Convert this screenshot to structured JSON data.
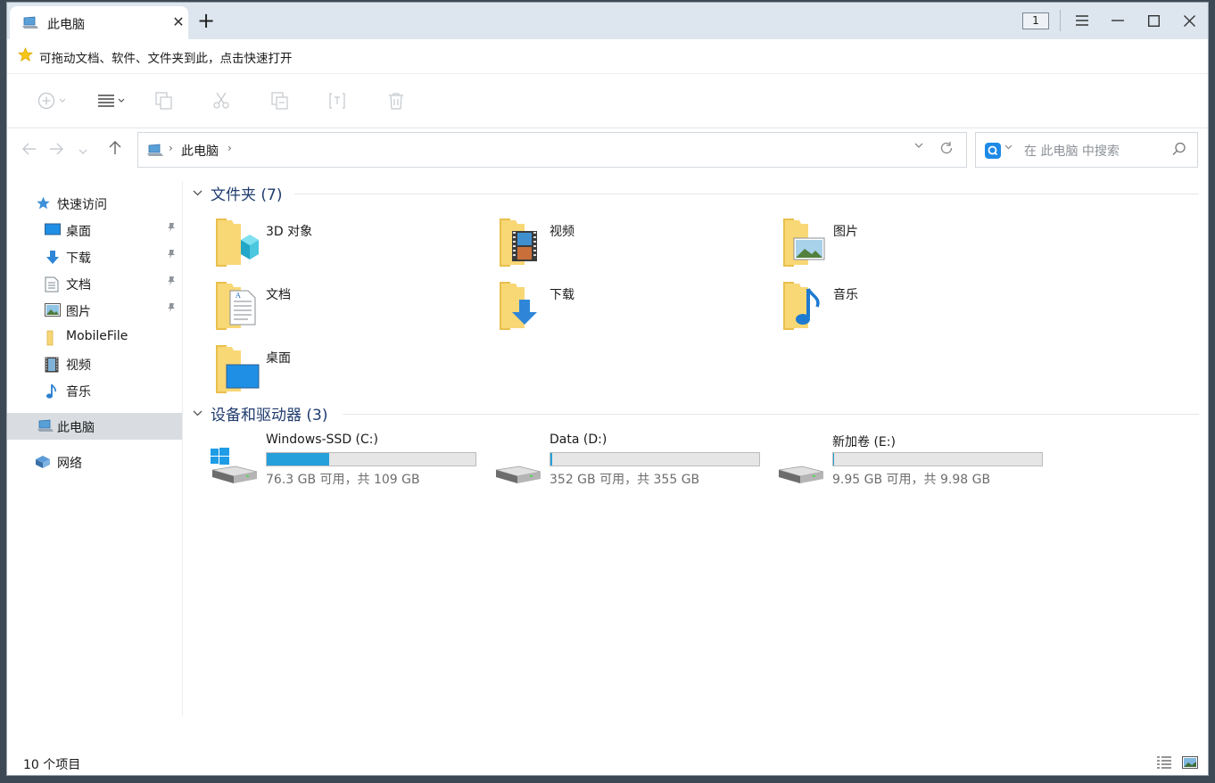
{
  "window": {
    "tab_title": "此电脑",
    "tab_close": "✕",
    "new_tab": "+",
    "tab_count": "1"
  },
  "quick_bar": {
    "text": "可拖动文档、软件、文件夹到此，点击快速打开"
  },
  "address": {
    "path": "此电脑",
    "separator": "›"
  },
  "search": {
    "placeholder": "在 此电脑 中搜索"
  },
  "sidebar": {
    "quick_access": "快速访问",
    "items": [
      {
        "label": "桌面",
        "icon": "desktop-icon",
        "pinned": true
      },
      {
        "label": "下载",
        "icon": "download-icon",
        "pinned": true
      },
      {
        "label": "文档",
        "icon": "document-icon",
        "pinned": true
      },
      {
        "label": "图片",
        "icon": "picture-icon",
        "pinned": true
      },
      {
        "label": "MobileFile",
        "icon": "folder-icon",
        "pinned": false
      },
      {
        "label": "视频",
        "icon": "video-icon",
        "pinned": false
      },
      {
        "label": "音乐",
        "icon": "music-icon",
        "pinned": false
      }
    ],
    "this_pc": "此电脑",
    "network": "网络"
  },
  "main": {
    "folders_header": "文件夹 (7)",
    "folders": [
      {
        "name": "3D 对象",
        "icon": "3d-objects-folder-icon"
      },
      {
        "name": "视频",
        "icon": "videos-folder-icon"
      },
      {
        "name": "图片",
        "icon": "pictures-folder-icon"
      },
      {
        "name": "文档",
        "icon": "documents-folder-icon"
      },
      {
        "name": "下载",
        "icon": "downloads-folder-icon"
      },
      {
        "name": "音乐",
        "icon": "music-folder-icon"
      },
      {
        "name": "桌面",
        "icon": "desktop-folder-icon"
      }
    ],
    "drives_header": "设备和驱动器 (3)",
    "drives": [
      {
        "name": "Windows-SSD (C:)",
        "info": "76.3 GB 可用，共 109 GB",
        "used_fraction": 0.3
      },
      {
        "name": "Data (D:)",
        "info": "352 GB 可用，共 355 GB",
        "used_fraction": 0.01
      },
      {
        "name": "新加卷 (E:)",
        "info": "9.95 GB 可用，共 9.98 GB",
        "used_fraction": 0.003
      }
    ]
  },
  "status": {
    "item_count": "10 个项目"
  },
  "colors": {
    "tabbar_bg": "#dde6ef",
    "drive_bar_fill": "#26a0da",
    "group_header": "#1f3b6e",
    "folder_yellow": "#f8d775"
  }
}
